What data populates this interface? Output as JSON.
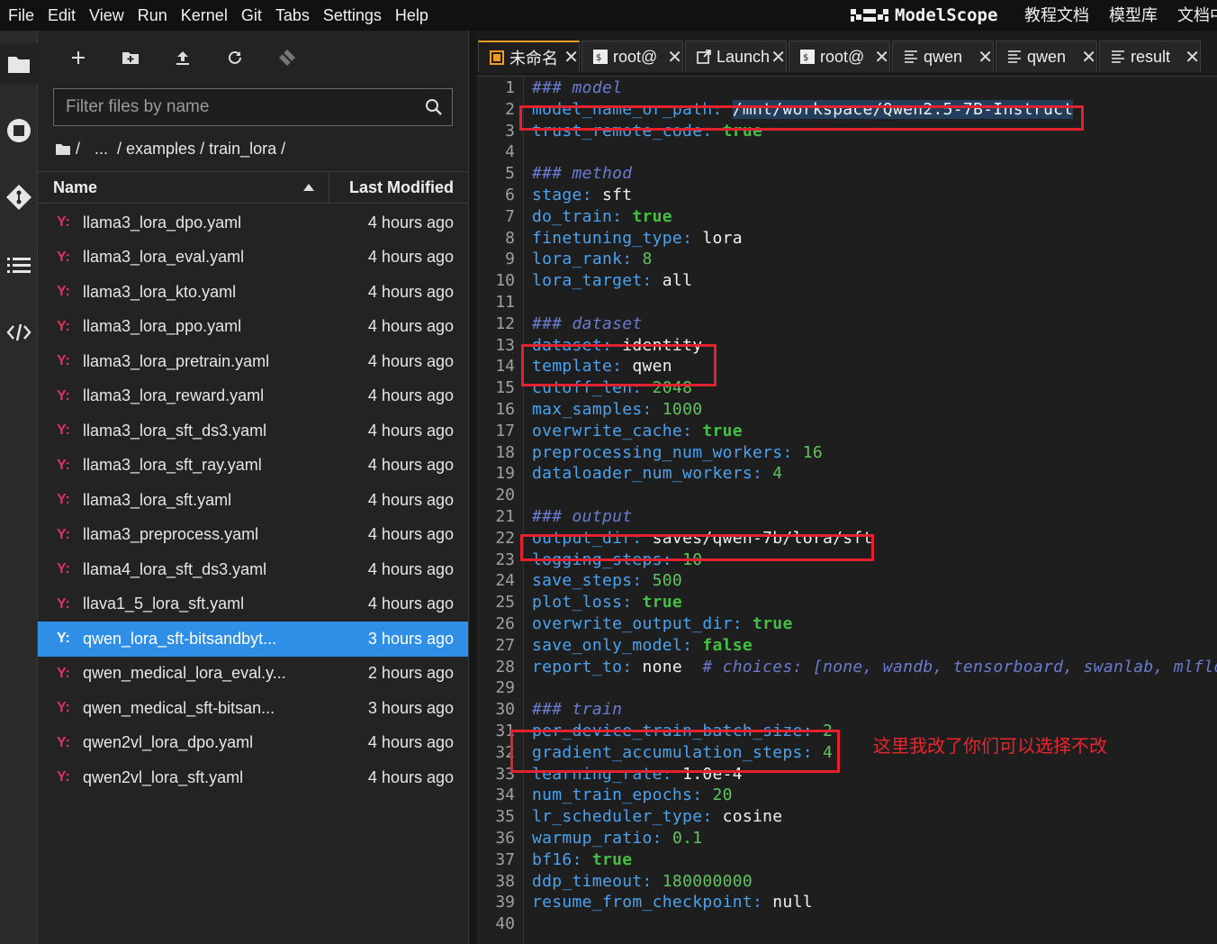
{
  "menubar": {
    "items": [
      "File",
      "Edit",
      "View",
      "Run",
      "Kernel",
      "Git",
      "Tabs",
      "Settings",
      "Help"
    ],
    "brand": "ModelScope",
    "links": [
      "教程文档",
      "模型库",
      "文档中"
    ]
  },
  "activitybar": {
    "icons": [
      "folder-icon",
      "stop-circle-icon",
      "git-icon",
      "list-icon",
      "code-icon"
    ]
  },
  "filebrowser": {
    "toolbar": [
      "new-launcher-icon",
      "new-folder-icon",
      "upload-icon",
      "refresh-icon",
      "git-clone-icon"
    ],
    "filter_placeholder": "Filter files by name",
    "breadcrumb": {
      "root": "/",
      "ellipsis": "...",
      "path": "/ examples / train_lora /"
    },
    "columns": {
      "name": "Name",
      "modified": "Last Modified"
    },
    "file_icon_glyph": "Y:",
    "files": [
      {
        "name": "llama3_lora_dpo.yaml",
        "modified": "4 hours ago"
      },
      {
        "name": "llama3_lora_eval.yaml",
        "modified": "4 hours ago"
      },
      {
        "name": "llama3_lora_kto.yaml",
        "modified": "4 hours ago"
      },
      {
        "name": "llama3_lora_ppo.yaml",
        "modified": "4 hours ago"
      },
      {
        "name": "llama3_lora_pretrain.yaml",
        "modified": "4 hours ago"
      },
      {
        "name": "llama3_lora_reward.yaml",
        "modified": "4 hours ago"
      },
      {
        "name": "llama3_lora_sft_ds3.yaml",
        "modified": "4 hours ago"
      },
      {
        "name": "llama3_lora_sft_ray.yaml",
        "modified": "4 hours ago"
      },
      {
        "name": "llama3_lora_sft.yaml",
        "modified": "4 hours ago"
      },
      {
        "name": "llama3_preprocess.yaml",
        "modified": "4 hours ago"
      },
      {
        "name": "llama4_lora_sft_ds3.yaml",
        "modified": "4 hours ago"
      },
      {
        "name": "llava1_5_lora_sft.yaml",
        "modified": "4 hours ago"
      },
      {
        "name": "qwen_lora_sft-bitsandbyt...",
        "modified": "3 hours ago",
        "selected": true
      },
      {
        "name": "qwen_medical_lora_eval.y...",
        "modified": "2 hours ago"
      },
      {
        "name": "qwen_medical_sft-bitsan...",
        "modified": "3 hours ago"
      },
      {
        "name": "qwen2vl_lora_dpo.yaml",
        "modified": "4 hours ago"
      },
      {
        "name": "qwen2vl_lora_sft.yaml",
        "modified": "4 hours ago"
      }
    ]
  },
  "tabs": [
    {
      "label": "未命名",
      "icon": "notebook-icon",
      "active": true
    },
    {
      "label": "root@",
      "icon": "terminal-icon"
    },
    {
      "label": "Launcher",
      "icon": "launcher-icon"
    },
    {
      "label": "root@",
      "icon": "terminal-icon"
    },
    {
      "label": "qwen",
      "icon": "text-file-icon"
    },
    {
      "label": "qwen",
      "icon": "text-file-icon"
    },
    {
      "label": "result",
      "icon": "text-file-icon"
    }
  ],
  "editor": {
    "lines": [
      [
        [
          "c",
          "### model"
        ]
      ],
      [
        [
          "k",
          "model_name_or_path"
        ],
        [
          "k",
          ": "
        ],
        [
          "v",
          "/mnt/workspace/Qwen2.5-7B-Instruct"
        ]
      ],
      [
        [
          "k",
          "trust_remote_code"
        ],
        [
          "k",
          ": "
        ],
        [
          "b",
          "true"
        ]
      ],
      [],
      [
        [
          "c",
          "### method"
        ]
      ],
      [
        [
          "k",
          "stage"
        ],
        [
          "k",
          ": "
        ],
        [
          "v",
          "sft"
        ]
      ],
      [
        [
          "k",
          "do_train"
        ],
        [
          "k",
          ": "
        ],
        [
          "b",
          "true"
        ]
      ],
      [
        [
          "k",
          "finetuning_type"
        ],
        [
          "k",
          ": "
        ],
        [
          "v",
          "lora"
        ]
      ],
      [
        [
          "k",
          "lora_rank"
        ],
        [
          "k",
          ": "
        ],
        [
          "n",
          "8"
        ]
      ],
      [
        [
          "k",
          "lora_target"
        ],
        [
          "k",
          ": "
        ],
        [
          "v",
          "all"
        ]
      ],
      [],
      [
        [
          "c",
          "### dataset"
        ]
      ],
      [
        [
          "k",
          "dataset"
        ],
        [
          "k",
          ": "
        ],
        [
          "v",
          "identity"
        ]
      ],
      [
        [
          "k",
          "template"
        ],
        [
          "k",
          ": "
        ],
        [
          "v",
          "qwen"
        ]
      ],
      [
        [
          "k",
          "cutoff_len"
        ],
        [
          "k",
          ": "
        ],
        [
          "n",
          "2048"
        ]
      ],
      [
        [
          "k",
          "max_samples"
        ],
        [
          "k",
          ": "
        ],
        [
          "n",
          "1000"
        ]
      ],
      [
        [
          "k",
          "overwrite_cache"
        ],
        [
          "k",
          ": "
        ],
        [
          "b",
          "true"
        ]
      ],
      [
        [
          "k",
          "preprocessing_num_workers"
        ],
        [
          "k",
          ": "
        ],
        [
          "n",
          "16"
        ]
      ],
      [
        [
          "k",
          "dataloader_num_workers"
        ],
        [
          "k",
          ": "
        ],
        [
          "n",
          "4"
        ]
      ],
      [],
      [
        [
          "c",
          "### output"
        ]
      ],
      [
        [
          "k",
          "output_dir"
        ],
        [
          "k",
          ": "
        ],
        [
          "v",
          "saves/qwen-7b/lora/sft"
        ]
      ],
      [
        [
          "k",
          "logging_steps"
        ],
        [
          "k",
          ": "
        ],
        [
          "n",
          "10"
        ]
      ],
      [
        [
          "k",
          "save_steps"
        ],
        [
          "k",
          ": "
        ],
        [
          "n",
          "500"
        ]
      ],
      [
        [
          "k",
          "plot_loss"
        ],
        [
          "k",
          ": "
        ],
        [
          "b",
          "true"
        ]
      ],
      [
        [
          "k",
          "overwrite_output_dir"
        ],
        [
          "k",
          ": "
        ],
        [
          "b",
          "true"
        ]
      ],
      [
        [
          "k",
          "save_only_model"
        ],
        [
          "k",
          ": "
        ],
        [
          "b",
          "false"
        ]
      ],
      [
        [
          "k",
          "report_to"
        ],
        [
          "k",
          ": "
        ],
        [
          "v",
          "none  "
        ],
        [
          "c",
          "# choices: [none, wandb, tensorboard, swanlab, mlflow]"
        ]
      ],
      [],
      [
        [
          "c",
          "### train"
        ]
      ],
      [
        [
          "k",
          "per_device_train_batch_size"
        ],
        [
          "k",
          ": "
        ],
        [
          "n",
          "2"
        ]
      ],
      [
        [
          "k",
          "gradient_accumulation_steps"
        ],
        [
          "k",
          ": "
        ],
        [
          "n",
          "4"
        ]
      ],
      [
        [
          "k",
          "learning_rate"
        ],
        [
          "k",
          ": "
        ],
        [
          "v",
          "1.0e-4"
        ]
      ],
      [
        [
          "k",
          "num_train_epochs"
        ],
        [
          "k",
          ": "
        ],
        [
          "n",
          "20"
        ]
      ],
      [
        [
          "k",
          "lr_scheduler_type"
        ],
        [
          "k",
          ": "
        ],
        [
          "v",
          "cosine"
        ]
      ],
      [
        [
          "k",
          "warmup_ratio"
        ],
        [
          "k",
          ": "
        ],
        [
          "n",
          "0.1"
        ]
      ],
      [
        [
          "k",
          "bf16"
        ],
        [
          "k",
          ": "
        ],
        [
          "b",
          "true"
        ]
      ],
      [
        [
          "k",
          "ddp_timeout"
        ],
        [
          "k",
          ": "
        ],
        [
          "n",
          "180000000"
        ]
      ],
      [
        [
          "k",
          "resume_from_checkpoint"
        ],
        [
          "k",
          ": "
        ],
        [
          "v",
          "null"
        ]
      ],
      []
    ]
  },
  "annotation": "这里我改了你们可以选择不改",
  "colors": {
    "accent": "#2f8ee6",
    "highlight_box": "#e3222f",
    "active_tab": "#f09b23",
    "yaml_icon": "#e0325f"
  }
}
